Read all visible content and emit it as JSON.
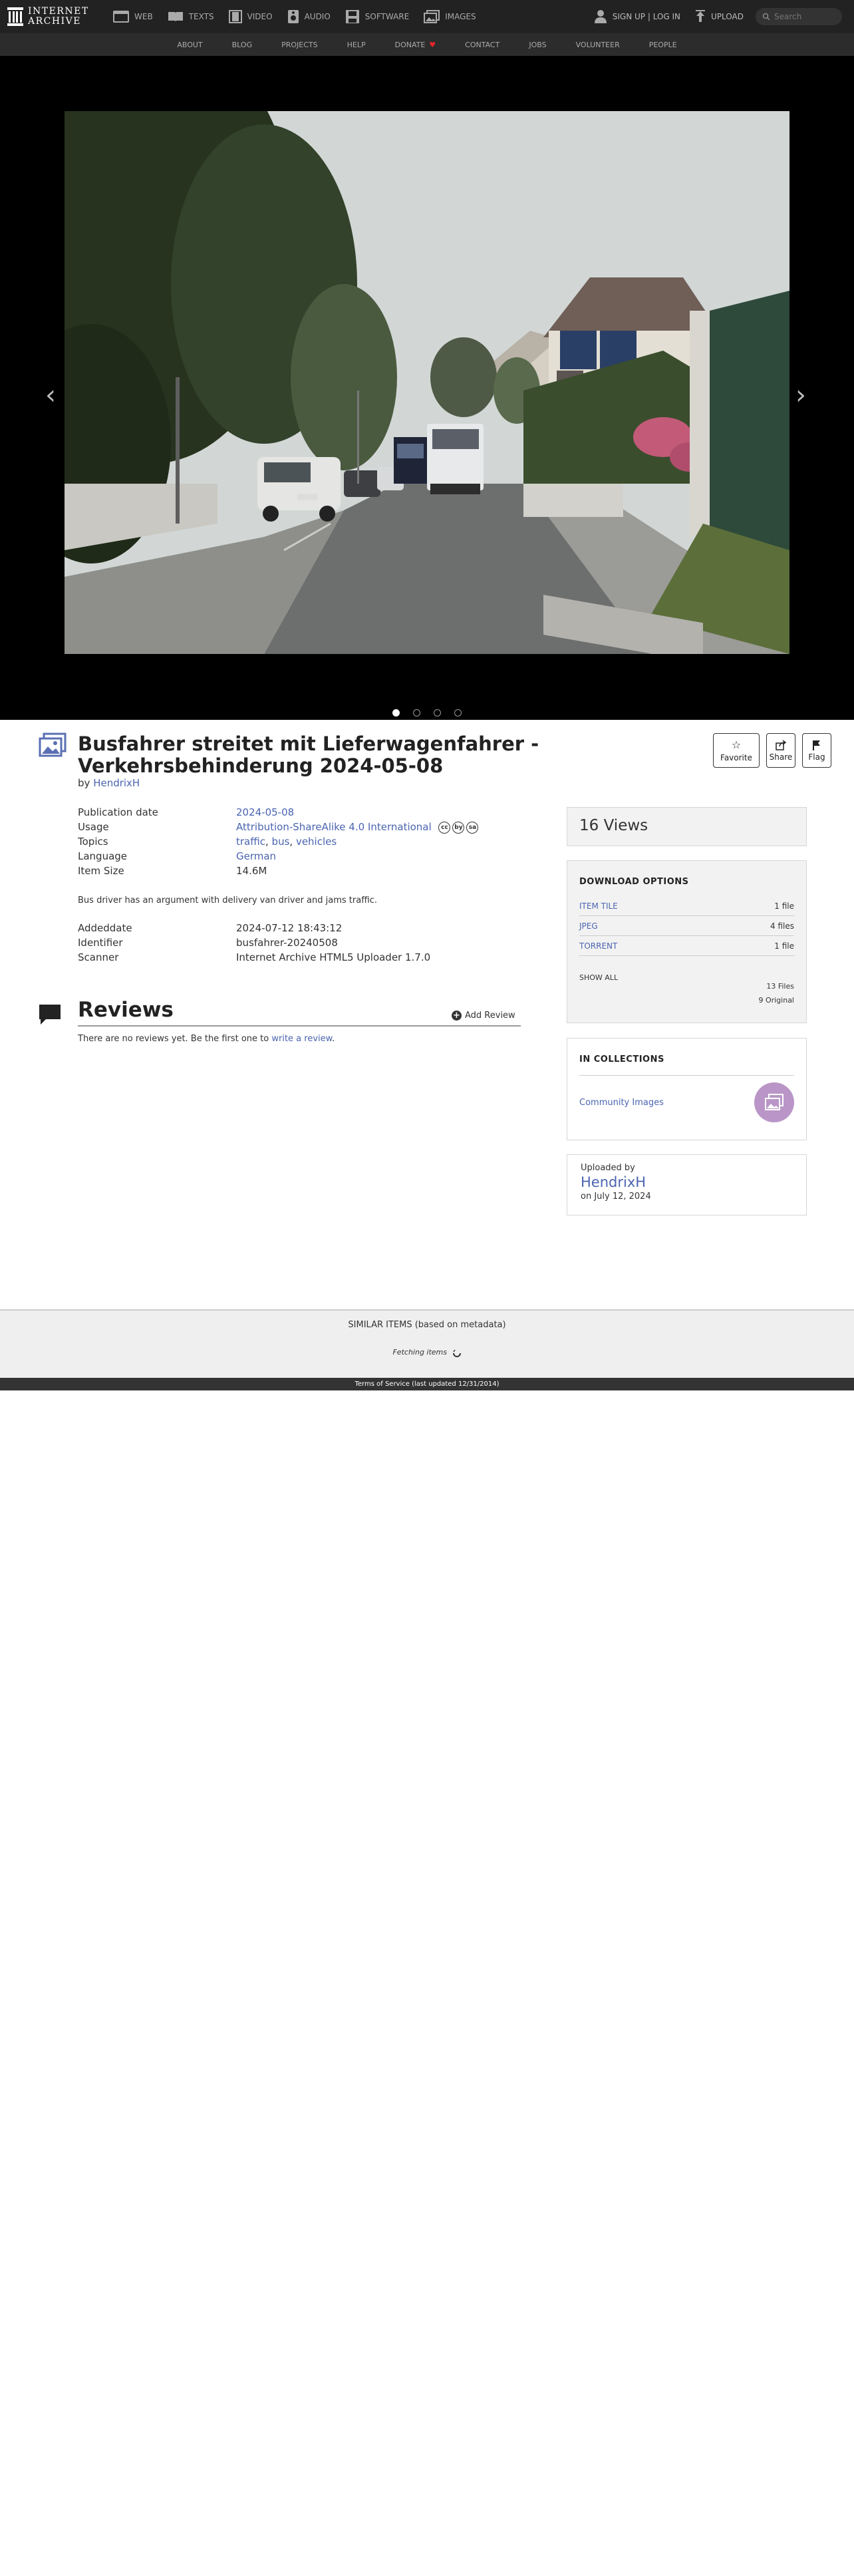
{
  "topnav": {
    "logo_line1": "INTERNET",
    "logo_line2": "ARCHIVE",
    "items": [
      {
        "label": "WEB",
        "icon": "web-icon"
      },
      {
        "label": "TEXTS",
        "icon": "texts-icon"
      },
      {
        "label": "VIDEO",
        "icon": "video-icon"
      },
      {
        "label": "AUDIO",
        "icon": "audio-icon"
      },
      {
        "label": "SOFTWARE",
        "icon": "software-icon"
      },
      {
        "label": "IMAGES",
        "icon": "images-icon"
      }
    ],
    "signin": "SIGN UP | LOG IN",
    "upload": "UPLOAD",
    "search_placeholder": "Search"
  },
  "subnav": [
    "ABOUT",
    "BLOG",
    "PROJECTS",
    "HELP",
    "DONATE",
    "CONTACT",
    "JOBS",
    "VOLUNTEER",
    "PEOPLE"
  ],
  "theatre": {
    "prev_glyph": "‹",
    "next_glyph": "›",
    "slide_count": 4,
    "active_slide": 1
  },
  "item": {
    "title": "Busfahrer streitet mit Lieferwagenfahrer - Verkehrsbehinderung 2024-05-08",
    "by_label": "by",
    "creator": "HendrixH",
    "actions": {
      "favorite": "Favorite",
      "share": "Share",
      "flag": "Flag"
    },
    "metadata": [
      {
        "key": "Publication date",
        "value": "2024-05-08"
      },
      {
        "key": "Usage",
        "value": "Attribution-ShareAlike 4.0 International"
      },
      {
        "key": "Topics",
        "values": [
          "traffic",
          "bus",
          "vehicles"
        ]
      },
      {
        "key": "Language",
        "value": "German"
      },
      {
        "key": "Item Size",
        "value": "14.6M"
      }
    ],
    "license_badges": [
      "cc",
      "by",
      "sa"
    ],
    "description": "Bus driver has an argument with delivery van driver and jams traffic.",
    "metadata2": [
      {
        "key": "Addeddate",
        "value": "2024-07-12 18:43:12"
      },
      {
        "key": "Identifier",
        "value": "busfahrer-20240508"
      },
      {
        "key": "Scanner",
        "value": "Internet Archive HTML5 Uploader 1.7.0"
      }
    ]
  },
  "reviews": {
    "title": "Reviews",
    "add_review": "Add Review",
    "empty_prefix": "There are no reviews yet. Be the first one to ",
    "empty_link": "write a review",
    "empty_suffix": "."
  },
  "sidebar": {
    "views": "16 Views",
    "download_title": "DOWNLOAD OPTIONS",
    "downloads": [
      {
        "format": "ITEM TILE",
        "count": "1 file"
      },
      {
        "format": "JPEG",
        "count": "4 files"
      },
      {
        "format": "TORRENT",
        "count": "1 file"
      }
    ],
    "show_all": "SHOW ALL",
    "total_files": "13 Files",
    "original": "9 Original",
    "collections_title": "IN COLLECTIONS",
    "collection": "Community Images",
    "uploaded_by_label": "Uploaded by",
    "uploader": "HendrixH",
    "upload_date": "on July 12, 2024"
  },
  "similar": {
    "heading": "SIMILAR ITEMS (based on metadata)",
    "fetching": "Fetching items"
  },
  "footer": {
    "text": "Terms of Service (last updated 12/31/2014)"
  },
  "colors": {
    "link": "#4a64b0",
    "topbar": "#222222",
    "donate_heart": "#e6252a",
    "collection_bubble": "#b996c7"
  }
}
